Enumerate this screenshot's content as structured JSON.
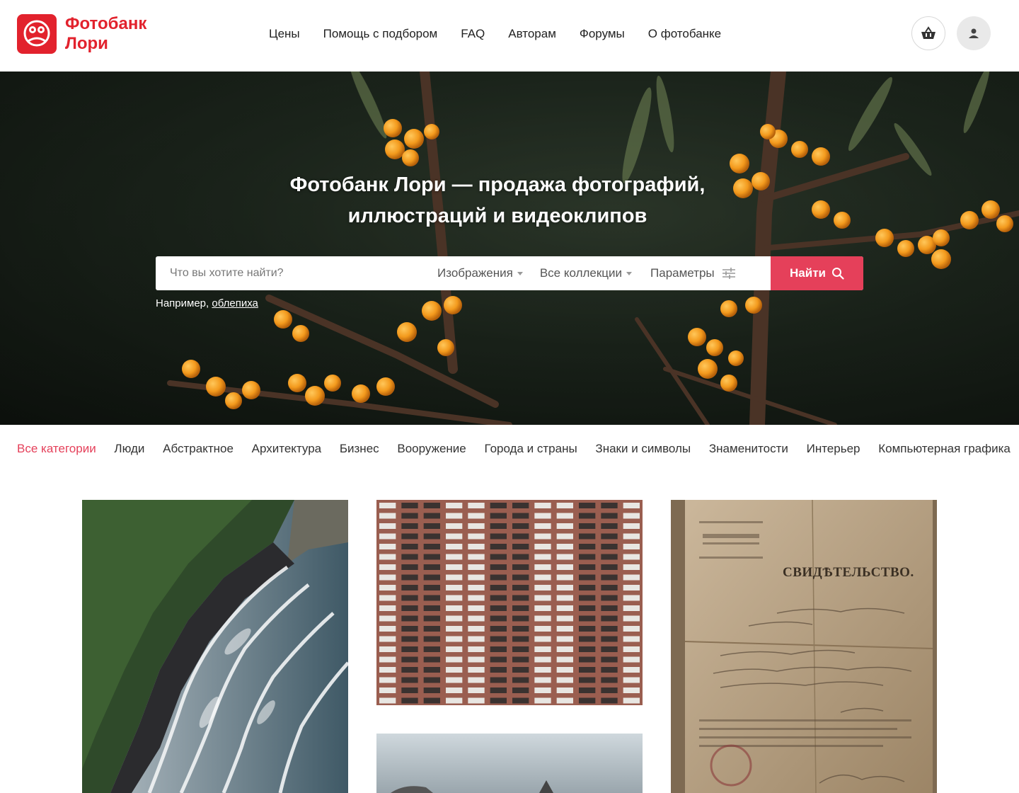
{
  "header": {
    "logo_line1": "Фотобанк",
    "logo_line2": "Лори",
    "nav": [
      "Цены",
      "Помощь с подбором",
      "FAQ",
      "Авторам",
      "Форумы",
      "О фотобанке"
    ]
  },
  "hero": {
    "title_line1": "Фотобанк Лори — продажа фотографий,",
    "title_line2": "иллюстраций и видеоклипов",
    "search_placeholder": "Что вы хотите найти?",
    "media_type": "Изображения",
    "collections": "Все коллекции",
    "params_label": "Параметры",
    "search_button": "Найти",
    "example_prefix": "Например,",
    "example_link": "облепиха"
  },
  "categories": [
    "Все категории",
    "Люди",
    "Абстрактное",
    "Архитектура",
    "Бизнес",
    "Вооружение",
    "Города и страны",
    "Знаки и символы",
    "Знаменитости",
    "Интерьер",
    "Компьютерная графика"
  ],
  "doc_tile": {
    "heading": "СВИДѢТЕЛЬСТВО."
  },
  "colors": {
    "brand": "#e2222d",
    "accent": "#e5405a"
  }
}
